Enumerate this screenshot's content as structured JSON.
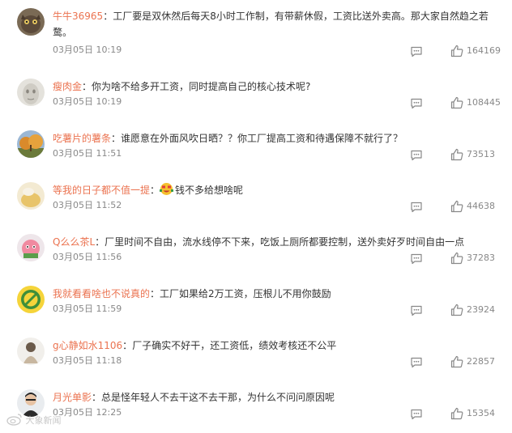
{
  "comments": [
    {
      "user": "牛牛36965",
      "text": "工厂要是双休然后每天8小时工作制，有带薪休假，工资比送外卖高。那大家自然趋之若鹜。",
      "date": "03月05日",
      "time": "10:19",
      "likes": "164169"
    },
    {
      "user": "瘦肉金",
      "text": "你为啥不给多开工资，同时提高自己的核心技术呢?",
      "date": "03月05日",
      "time": "10:19",
      "likes": "108445"
    },
    {
      "user": "吃薯片的薯条",
      "text": "谁愿意在外面风吹日晒？？你工厂提高工资和待遇保障不就行了？",
      "date": "03月05日",
      "time": "11:51",
      "likes": "73513"
    },
    {
      "user": "等我的日子都不值一提",
      "text": "钱不多给想啥呢",
      "date": "03月05日",
      "time": "11:52",
      "likes": "44638"
    },
    {
      "user": "Q么么茶L",
      "text": "厂里时间不自由，流水线停不下来，吃饭上厕所都要控制，送外卖好歹时间自由一点",
      "date": "03月05日",
      "time": "11:56",
      "likes": "37283"
    },
    {
      "user": "我就看看啥也不说真的",
      "text": "工厂如果给2万工资，压根儿不用你鼓励",
      "date": "03月05日",
      "time": "11:59",
      "likes": "23924"
    },
    {
      "user": "g心静如水1106",
      "text": "厂子确实不好干，还工资低，绩效考核还不公平",
      "date": "03月05日",
      "time": "11:18",
      "likes": "22857"
    },
    {
      "user": "月光单影",
      "text": "总是怪年轻人不去干这不去干那，为什么不问问原因呢",
      "date": "03月05日",
      "time": "12:25",
      "likes": "15354"
    }
  ],
  "separator": "：",
  "watermark": "大象新闻",
  "colors": {
    "username": "#eb7350",
    "text": "#333333",
    "meta": "#888888"
  },
  "icons": {
    "reply": "comment-icon",
    "like": "thumbs-up-icon"
  }
}
